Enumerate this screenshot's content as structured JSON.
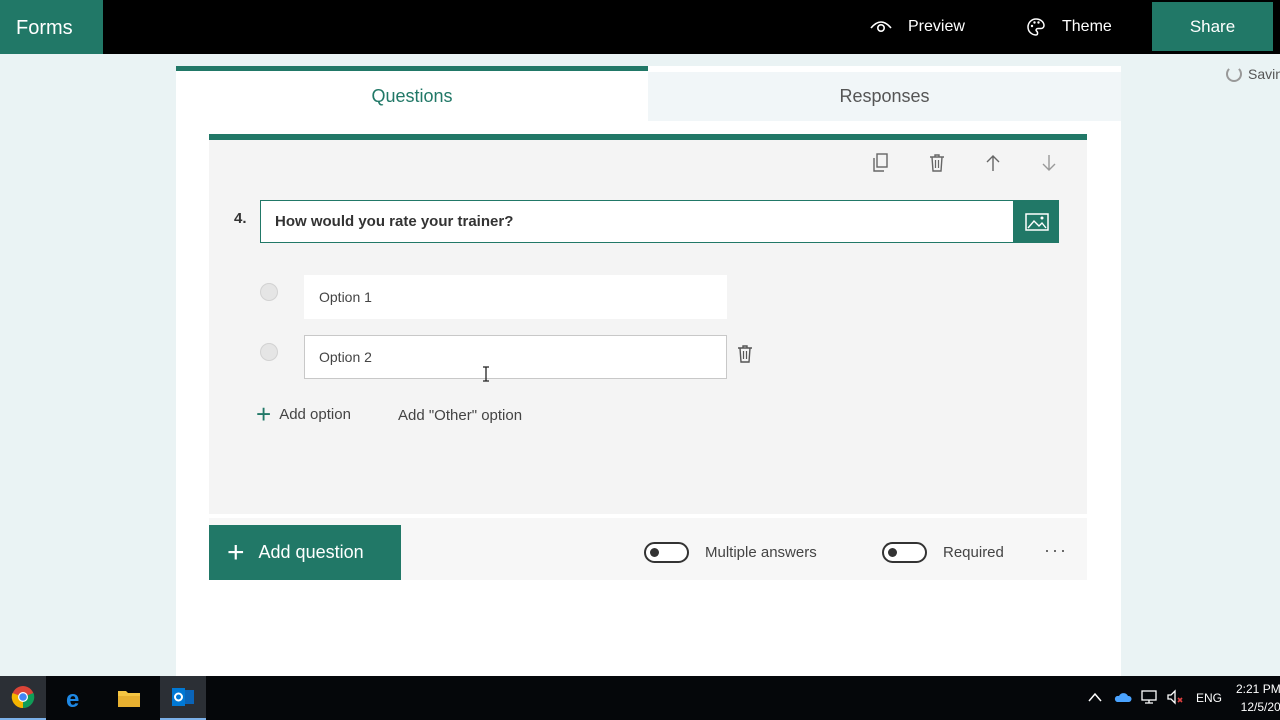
{
  "topbar": {
    "app_name": "Forms",
    "preview_label": "Preview",
    "theme_label": "Theme",
    "share_label": "Share",
    "status": "Savin"
  },
  "tabs": {
    "questions": "Questions",
    "responses": "Responses"
  },
  "question": {
    "number": "4.",
    "text": "How would you rate your trainer?",
    "options": [
      {
        "placeholder": "Option 1"
      },
      {
        "placeholder": "Option 2"
      }
    ],
    "add_option": "Add option",
    "add_other": "Add \"Other\" option",
    "multiple_answers_label": "Multiple answers",
    "required_label": "Required",
    "more": "···"
  },
  "add_question_label": "Add question",
  "taskbar": {
    "language": "ENG",
    "time": "2:21 PM",
    "date": "12/5/20"
  },
  "colors": {
    "accent": "#217867",
    "topbar": "#000000"
  }
}
